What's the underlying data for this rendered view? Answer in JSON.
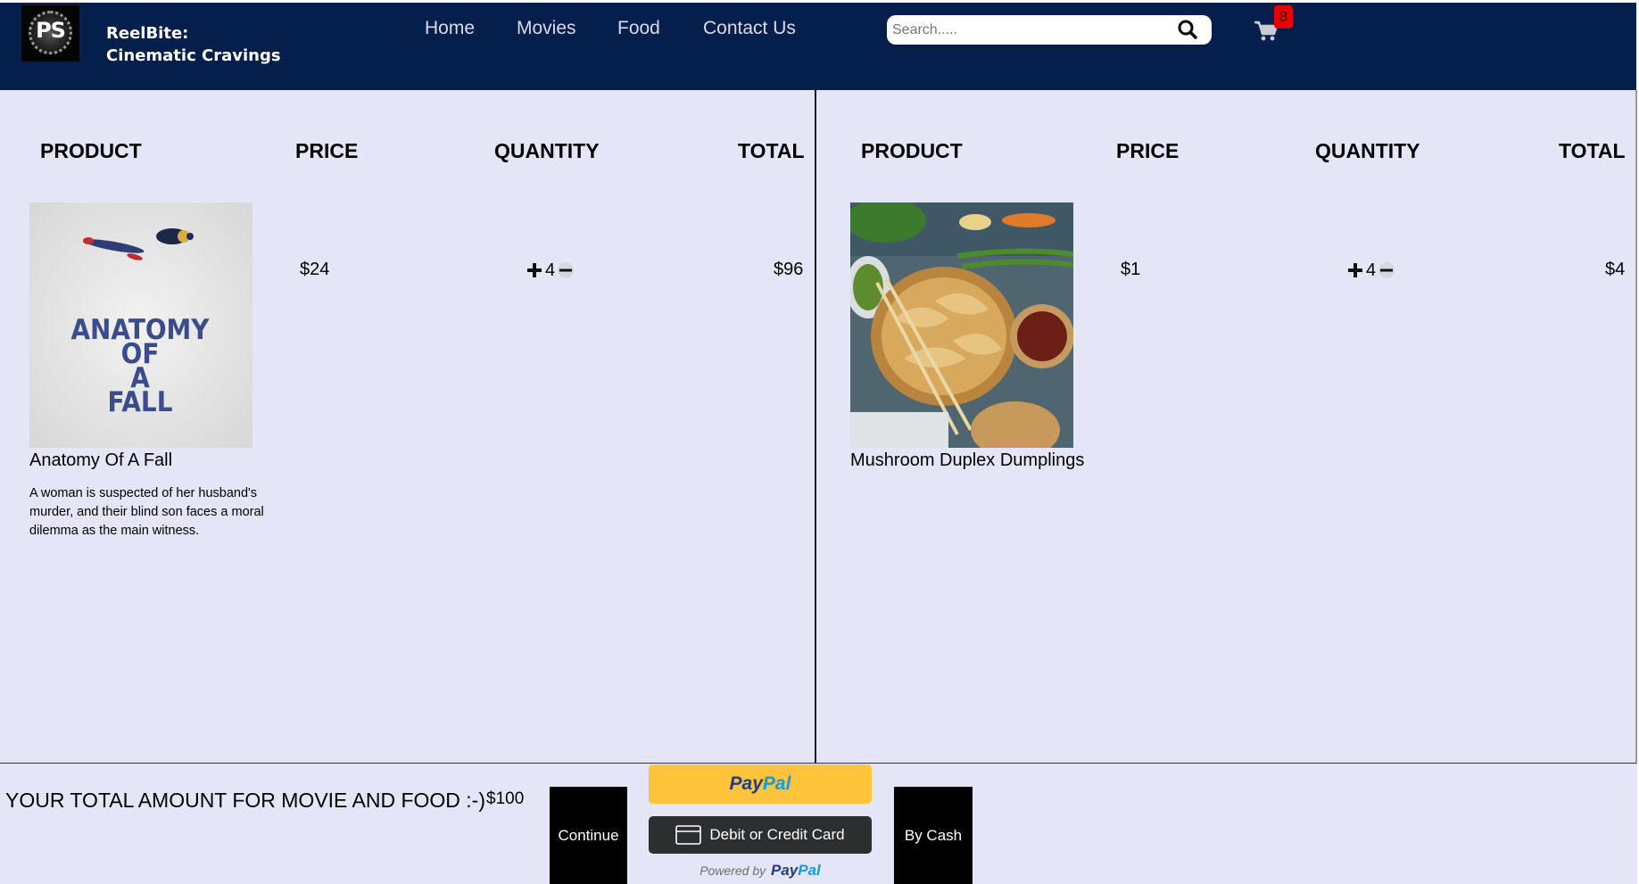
{
  "header": {
    "logo_text": "PS",
    "brand_line1": "ReelBite:",
    "brand_line2": "Cinematic Cravings",
    "nav": [
      "Home",
      "Movies",
      "Food",
      "Contact Us"
    ],
    "search_placeholder": "Search.....",
    "cart_count": "8",
    "colors": {
      "header_bg": "#041f4b",
      "badge": "#e60000"
    },
    "icons": [
      "search-icon",
      "cart-icon"
    ]
  },
  "movie_cart": {
    "columns": [
      "PRODUCT",
      "PRICE",
      "QUANTITY",
      "TOTAL"
    ],
    "items": [
      {
        "poster_title": "ANATOMY OF A FALL",
        "name": "Anatomy Of A Fall",
        "description": "A woman is suspected of her husband's murder, and their blind son faces a moral dilemma as the main witness.",
        "price": "$24",
        "quantity": "4",
        "total": "$96"
      }
    ]
  },
  "food_cart": {
    "columns": [
      "PRODUCT",
      "PRICE",
      "QUANTITY",
      "TOTAL"
    ],
    "items": [
      {
        "name": "Mushroom Duplex Dumplings",
        "price": "$1",
        "quantity": "4",
        "total": "$4"
      }
    ]
  },
  "footer": {
    "total_label": "YOUR TOTAL AMOUNT FOR MOVIE AND FOOD :-)",
    "total_value": "$100",
    "continue_label": "Continue",
    "paypal_pay": "Pay",
    "paypal_pal": "Pal",
    "card_label": "Debit or Credit Card",
    "powered_by": "Powered by",
    "powered_pay": "Pay",
    "powered_pal": "Pal",
    "cash_label": "By Cash",
    "colors": {
      "paypal_yellow": "#ffc439",
      "paypal_dark": "#253b80",
      "paypal_light": "#179bd7"
    }
  }
}
